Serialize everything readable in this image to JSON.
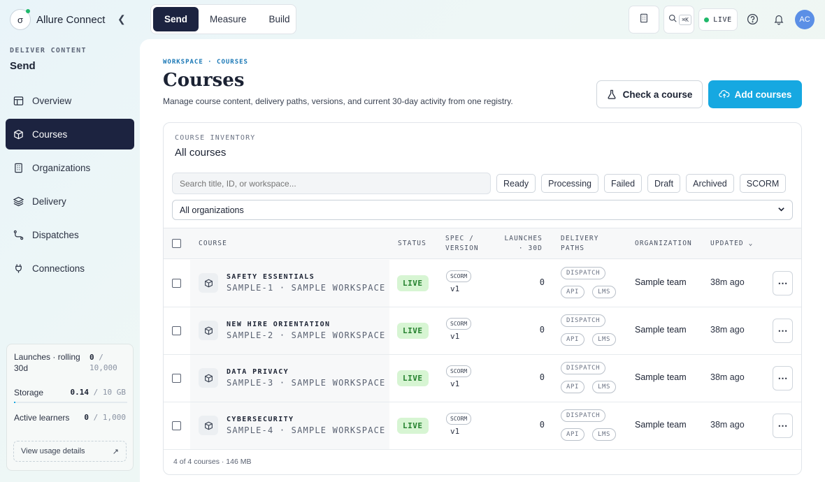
{
  "app": {
    "name": "Allure Connect",
    "logo_glyph": "σ"
  },
  "sidebar": {
    "section_label": "DELIVER CONTENT",
    "section_title": "Send",
    "items": [
      {
        "label": "Overview",
        "icon": "table-icon",
        "active": false
      },
      {
        "label": "Courses",
        "icon": "package-icon",
        "active": true
      },
      {
        "label": "Organizations",
        "icon": "building-icon",
        "active": false
      },
      {
        "label": "Delivery",
        "icon": "layers-icon",
        "active": false
      },
      {
        "label": "Dispatches",
        "icon": "route-icon",
        "active": false
      },
      {
        "label": "Connections",
        "icon": "plug-icon",
        "active": false
      }
    ],
    "usage": {
      "launches_label": "Launches · rolling 30d",
      "launches_value": "0",
      "launches_limit": "/ 10,000",
      "storage_label": "Storage",
      "storage_value": "0.14",
      "storage_limit": "/ 10 GB",
      "storage_fraction": 0.014,
      "learners_label": "Active learners",
      "learners_value": "0",
      "learners_limit": "/ 1,000",
      "link_label": "View usage details"
    }
  },
  "topbar": {
    "tabs": [
      "Send",
      "Measure",
      "Build"
    ],
    "active_tab": "Send",
    "search_shortcut": "⌘K",
    "live_label": "LIVE",
    "avatar_initials": "AC"
  },
  "page": {
    "breadcrumb": "WORKSPACE · COURSES",
    "title": "Courses",
    "description": "Manage course content, delivery paths, versions, and current 30-day activity from one registry.",
    "check_button": "Check a course",
    "add_button": "Add courses"
  },
  "inventory": {
    "label": "COURSE INVENTORY",
    "title": "All courses",
    "search_placeholder": "Search title, ID, or workspace...",
    "filters": [
      "Ready",
      "Processing",
      "Failed",
      "Draft",
      "Archived",
      "SCORM"
    ],
    "org_select": "All organizations",
    "columns": {
      "course": "COURSE",
      "status": "STATUS",
      "spec_1": "SPEC /",
      "spec_2": "VERSION",
      "launches_1": "LAUNCHES",
      "launches_2": "· 30D",
      "delivery_1": "DELIVERY",
      "delivery_2": "PATHS",
      "organization": "ORGANIZATION",
      "updated": "UPDATED"
    },
    "rows": [
      {
        "title": "SAFETY ESSENTIALS",
        "sub": "SAMPLE-1 · SAMPLE WORKSPACE",
        "status": "LIVE",
        "spec": "SCORM",
        "version": "v1",
        "launches": "0",
        "paths": [
          "DISPATCH",
          "API",
          "LMS"
        ],
        "org": "Sample team",
        "updated": "38m ago"
      },
      {
        "title": "NEW HIRE ORIENTATION",
        "sub": "SAMPLE-2 · SAMPLE WORKSPACE",
        "status": "LIVE",
        "spec": "SCORM",
        "version": "v1",
        "launches": "0",
        "paths": [
          "DISPATCH",
          "API",
          "LMS"
        ],
        "org": "Sample team",
        "updated": "38m ago"
      },
      {
        "title": "DATA PRIVACY",
        "sub": "SAMPLE-3 · SAMPLE WORKSPACE",
        "status": "LIVE",
        "spec": "SCORM",
        "version": "v1",
        "launches": "0",
        "paths": [
          "DISPATCH",
          "API",
          "LMS"
        ],
        "org": "Sample team",
        "updated": "38m ago"
      },
      {
        "title": "CYBERSECURITY",
        "sub": "SAMPLE-4 · SAMPLE WORKSPACE",
        "status": "LIVE",
        "spec": "SCORM",
        "version": "v1",
        "launches": "0",
        "paths": [
          "DISPATCH",
          "API",
          "LMS"
        ],
        "org": "Sample team",
        "updated": "38m ago"
      }
    ],
    "footer": "4 of 4 courses · 146 MB"
  },
  "colors": {
    "accent": "#16a8e1",
    "nav_active": "#1c2340",
    "live_bg": "#d7f5d3",
    "live_text": "#23802d"
  }
}
